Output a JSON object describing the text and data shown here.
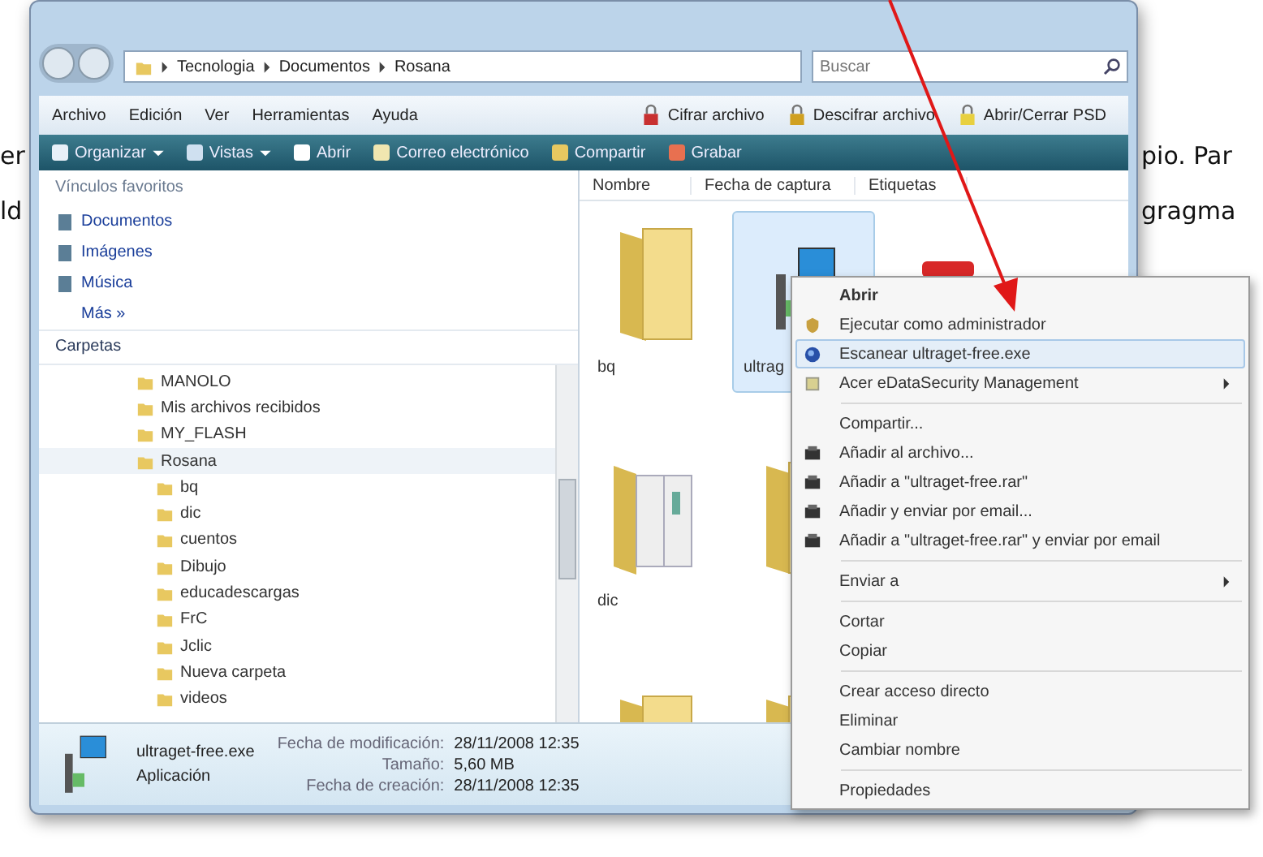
{
  "document": {
    "left": [
      "er",
      "ld"
    ],
    "right": [
      "pio. Par",
      "gragma"
    ]
  },
  "address_bar": {
    "path": [
      "Tecnologia",
      "Documentos",
      "Rosana"
    ],
    "search_placeholder": "Buscar"
  },
  "menu_bar": {
    "items": [
      "Archivo",
      "Edición",
      "Ver",
      "Herramientas",
      "Ayuda"
    ],
    "actions": [
      {
        "label": "Cifrar archivo",
        "kind": "lock"
      },
      {
        "label": "Descifrar archivo",
        "kind": "unlock"
      },
      {
        "label": "Abrir/Cerrar PSD",
        "kind": "psd"
      }
    ]
  },
  "toolbar": [
    {
      "label": "Organizar",
      "dropdown": true,
      "kind": "organize"
    },
    {
      "label": "Vistas",
      "dropdown": true,
      "kind": "views"
    },
    {
      "label": "Abrir",
      "dropdown": false,
      "kind": "open"
    },
    {
      "label": "Correo electrónico",
      "dropdown": false,
      "kind": "mail"
    },
    {
      "label": "Compartir",
      "dropdown": false,
      "kind": "share"
    },
    {
      "label": "Grabar",
      "dropdown": false,
      "kind": "burn"
    }
  ],
  "sidebar": {
    "favorites_title": "Vínculos favoritos",
    "favorites": [
      "Documentos",
      "Imágenes",
      "Música"
    ],
    "more": "Más »",
    "folders_title": "Carpetas",
    "tree": [
      {
        "label": "MANOLO",
        "expanded": false
      },
      {
        "label": "Mis archivos recibidos",
        "expanded": false
      },
      {
        "label": "MY_FLASH",
        "expanded": false
      },
      {
        "label": "Rosana",
        "expanded": true,
        "children": [
          {
            "label": "bq"
          },
          {
            "label": "dic"
          },
          {
            "label": "cuentos"
          },
          {
            "label": "Dibujo"
          },
          {
            "label": "educadescargas"
          },
          {
            "label": "FrC"
          },
          {
            "label": "Jclic"
          },
          {
            "label": "Nueva carpeta"
          },
          {
            "label": "videos"
          }
        ]
      }
    ]
  },
  "columns": [
    "Nombre",
    "Fecha de captura",
    "Etiquetas"
  ],
  "items": [
    {
      "kind": "folder",
      "label": "bq",
      "selected": false
    },
    {
      "kind": "app",
      "label": "ultrag",
      "selected": true
    },
    {
      "kind": "installer",
      "selected": false
    },
    {
      "kind": "docs",
      "label": "dic",
      "selected": false
    },
    {
      "kind": "folder",
      "selected": false
    },
    {
      "kind": "folder",
      "selected": false
    },
    {
      "kind": "folder",
      "selected": false
    }
  ],
  "details": {
    "name": "ultraget-free.exe",
    "type": "Aplicación",
    "fields": [
      {
        "label": "Fecha de modificación:",
        "value": "28/11/2008 12:35"
      },
      {
        "label": "Tamaño:",
        "value": "5,60 MB"
      },
      {
        "label": "Fecha de creación:",
        "value": "28/11/2008 12:35"
      }
    ]
  },
  "context_menu": [
    {
      "kind": "default",
      "label": "Abrir",
      "selected": false,
      "submenu": false
    },
    {
      "kind": "admin",
      "label": "Ejecutar como administrador",
      "selected": false,
      "submenu": false
    },
    {
      "kind": "scan",
      "label": "Escanear ultraget-free.exe",
      "selected": true,
      "submenu": false
    },
    {
      "kind": "plugin",
      "label": "Acer eDataSecurity Management",
      "selected": false,
      "submenu": true
    },
    {
      "kind": "separator"
    },
    {
      "kind": "plain",
      "label": "Compartir...",
      "selected": false,
      "submenu": false
    },
    {
      "kind": "archive",
      "label": "Añadir al archivo...",
      "selected": false,
      "submenu": false
    },
    {
      "kind": "archive",
      "label": "Añadir a \"ultraget-free.rar\"",
      "selected": false,
      "submenu": false
    },
    {
      "kind": "archive",
      "label": "Añadir y enviar por email...",
      "selected": false,
      "submenu": false
    },
    {
      "kind": "archive",
      "label": "Añadir a \"ultraget-free.rar\" y enviar por email",
      "selected": false,
      "submenu": false
    },
    {
      "kind": "separator"
    },
    {
      "kind": "plain",
      "label": "Enviar a",
      "selected": false,
      "submenu": true
    },
    {
      "kind": "separator"
    },
    {
      "kind": "plain",
      "label": "Cortar",
      "selected": false,
      "submenu": false
    },
    {
      "kind": "plain",
      "label": "Copiar",
      "selected": false,
      "submenu": false
    },
    {
      "kind": "separator"
    },
    {
      "kind": "plain",
      "label": "Crear acceso directo",
      "selected": false,
      "submenu": false
    },
    {
      "kind": "plain",
      "label": "Eliminar",
      "selected": false,
      "submenu": false
    },
    {
      "kind": "plain",
      "label": "Cambiar nombre",
      "selected": false,
      "submenu": false
    },
    {
      "kind": "separator"
    },
    {
      "kind": "plain",
      "label": "Propiedades",
      "selected": false,
      "submenu": false
    }
  ]
}
